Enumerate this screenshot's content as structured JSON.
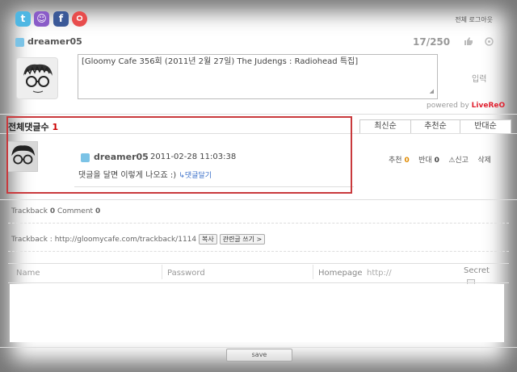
{
  "social": {
    "icons": [
      "twitter-icon",
      "me2day-icon",
      "facebook-icon",
      "yozm-icon"
    ]
  },
  "header": {
    "logout": "전체 로그아웃",
    "username": "dreamer05",
    "char_count": "17/250"
  },
  "composer": {
    "text": "[Gloomy Cafe 356회 (2011년 2월 27일) The Judengs : Radiohead 특집]",
    "submit": "입력",
    "powered_prefix": "powered by",
    "powered_brand": "LiveRe"
  },
  "comments": {
    "total_label": "전체댓글수",
    "total": "1",
    "sort": [
      "최신순",
      "추천순",
      "반대순"
    ],
    "items": [
      {
        "name": "dreamer05",
        "date": "2011-02-28 11:03:38",
        "body": "댓글을 달면 이렇게 나오죠 :)",
        "reply": "↳댓글달기",
        "recommend_label": "추천",
        "recommend": "0",
        "oppose_label": "반대",
        "oppose": "0",
        "report": "신고",
        "delete": "삭제"
      }
    ]
  },
  "trackback": {
    "label": "Trackback",
    "count": "0",
    "comment_label": "Comment",
    "comment_count": "0",
    "url_label": "Trackback :",
    "url": "http://gloomycafe.com/trackback/1114",
    "copy_btn": "복사",
    "write_btn": "관련글 쓰기 >"
  },
  "form": {
    "name_label": "Name",
    "password_label": "Password",
    "homepage_label": "Homepage",
    "homepage_placeholder": "http://",
    "secret_label": "Secret",
    "save": "save"
  },
  "colors": {
    "accent_red": "#c9393c",
    "brand": "#e0202f",
    "link_blue": "#3a6fc9",
    "count_orange": "#e08a00"
  }
}
